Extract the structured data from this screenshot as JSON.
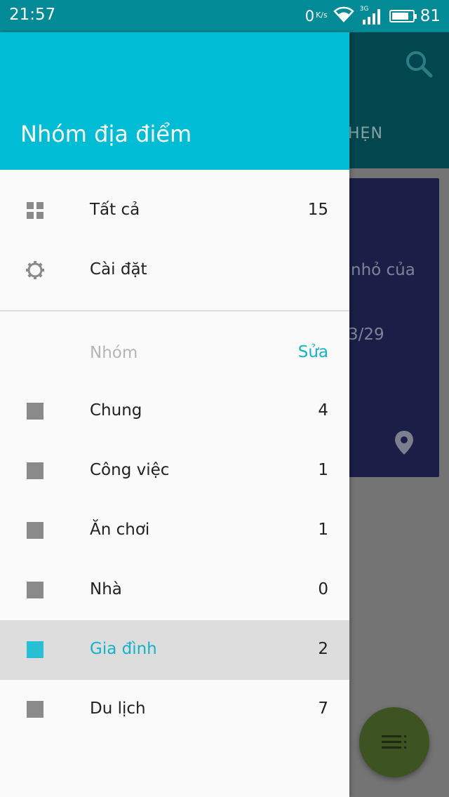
{
  "status_bar": {
    "time": "21:57",
    "net_speed": "0",
    "net_unit": "K/s",
    "signal_type": "3G",
    "battery_percent": "81",
    "battery_level": 0.81
  },
  "background": {
    "tab_label_partial": "HẸN",
    "card_text_partial": "nhỏ của",
    "card_date_partial": "3/29",
    "icons": [
      "search-icon",
      "location-pin-icon",
      "list-icon"
    ]
  },
  "drawer": {
    "title": "Nhóm địa điểm",
    "top_items": [
      {
        "label": "Tất cả",
        "count": "15",
        "icon": "grid-icon"
      },
      {
        "label": "Cài đặt",
        "count": "",
        "icon": "gear-icon"
      }
    ],
    "group_section": {
      "label": "Nhóm",
      "edit_label": "Sửa"
    },
    "groups": [
      {
        "label": "Chung",
        "count": "4",
        "selected": false
      },
      {
        "label": "Công việc",
        "count": "1",
        "selected": false
      },
      {
        "label": "Ăn chơi",
        "count": "1",
        "selected": false
      },
      {
        "label": "Nhà",
        "count": "0",
        "selected": false
      },
      {
        "label": "Gia đình",
        "count": "2",
        "selected": true
      },
      {
        "label": "Du lịch",
        "count": "7",
        "selected": false
      }
    ]
  },
  "colors": {
    "accent": "#00bcd4",
    "status_bar": "#028a97",
    "selected_bg": "#dddddd",
    "selected_text": "#12b3c9",
    "fab": "#3d5321",
    "card": "#1b1f47"
  }
}
